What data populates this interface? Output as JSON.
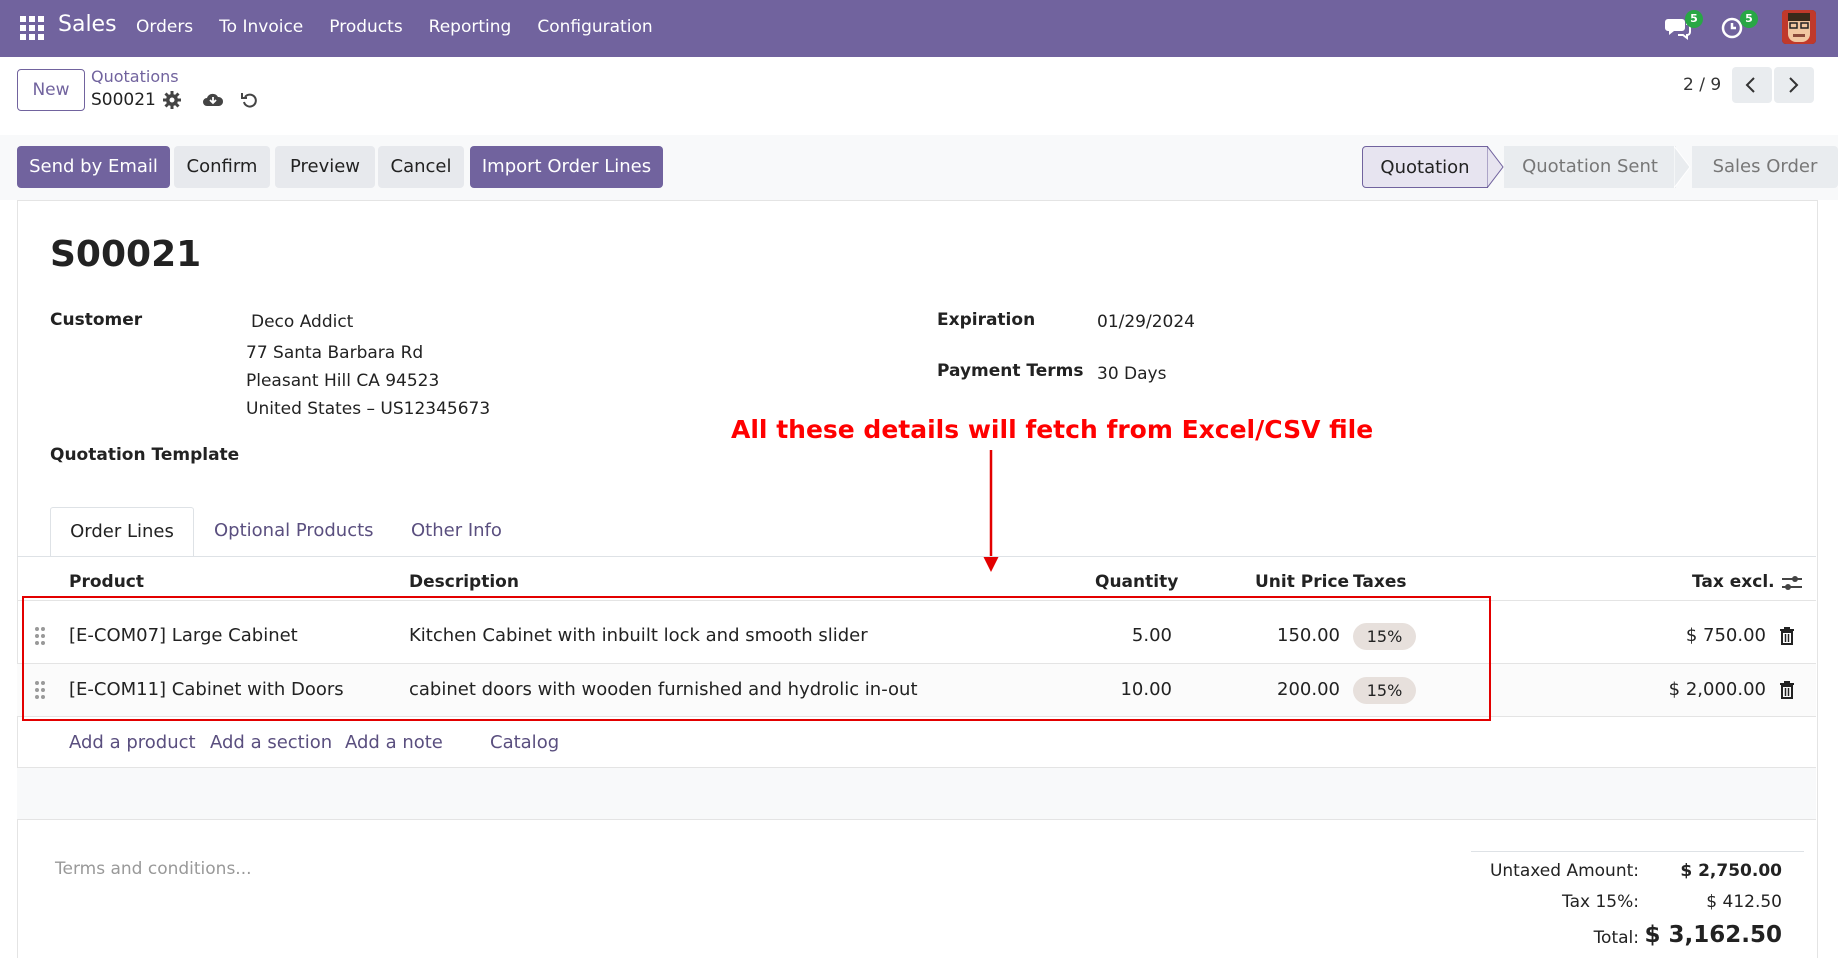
{
  "navbar": {
    "app_name": "Sales",
    "menu": [
      "Orders",
      "To Invoice",
      "Products",
      "Reporting",
      "Configuration"
    ],
    "messages_count": "5",
    "activities_count": "5"
  },
  "control_panel": {
    "new_label": "New",
    "breadcrumb_parent": "Quotations",
    "breadcrumb_current": "S00021",
    "pager": "2 / 9"
  },
  "actions": {
    "send_email": "Send by Email",
    "confirm": "Confirm",
    "preview": "Preview",
    "cancel": "Cancel",
    "import_lines": "Import Order Lines"
  },
  "statusbar": [
    "Quotation",
    "Quotation Sent",
    "Sales Order"
  ],
  "form": {
    "name": "S00021",
    "customer_label": "Customer",
    "customer_name": "Deco Addict",
    "address_line1": "77 Santa Barbara Rd",
    "address_line2": "Pleasant Hill CA 94523",
    "address_line3": "United States – US12345673",
    "expiration_label": "Expiration",
    "expiration_value": "01/29/2024",
    "payment_terms_label": "Payment Terms",
    "payment_terms_value": "30 Days",
    "template_label": "Quotation Template"
  },
  "annotation": "All these details will fetch from Excel/CSV file",
  "tabs": [
    "Order Lines",
    "Optional Products",
    "Other Info"
  ],
  "table": {
    "headers": {
      "product": "Product",
      "description": "Description",
      "quantity": "Quantity",
      "unit_price": "Unit Price",
      "taxes": "Taxes",
      "tax_excl": "Tax excl."
    },
    "rows": [
      {
        "product": "[E-COM07] Large Cabinet",
        "description": "Kitchen Cabinet with inbuilt lock and smooth slider",
        "quantity": "5.00",
        "unit_price": "150.00",
        "tax": "15%",
        "subtotal": "$ 750.00"
      },
      {
        "product": "[E-COM11] Cabinet with Doors",
        "description": "cabinet doors with wooden furnished and hydrolic in-out",
        "quantity": "10.00",
        "unit_price": "200.00",
        "tax": "15%",
        "subtotal": "$ 2,000.00"
      }
    ],
    "add_product": "Add a product",
    "add_section": "Add a section",
    "add_note": "Add a note",
    "catalog": "Catalog"
  },
  "terms_placeholder": "Terms and conditions...",
  "totals": {
    "untaxed_label": "Untaxed Amount:",
    "untaxed_value": "$ 2,750.00",
    "tax_label": "Tax 15%:",
    "tax_value": "$ 412.50",
    "total_label": "Total:",
    "total_value": "$ 3,162.50"
  },
  "colors": {
    "brand": "#71639e",
    "annotation": "#ff0000",
    "badge": "#28a745"
  }
}
